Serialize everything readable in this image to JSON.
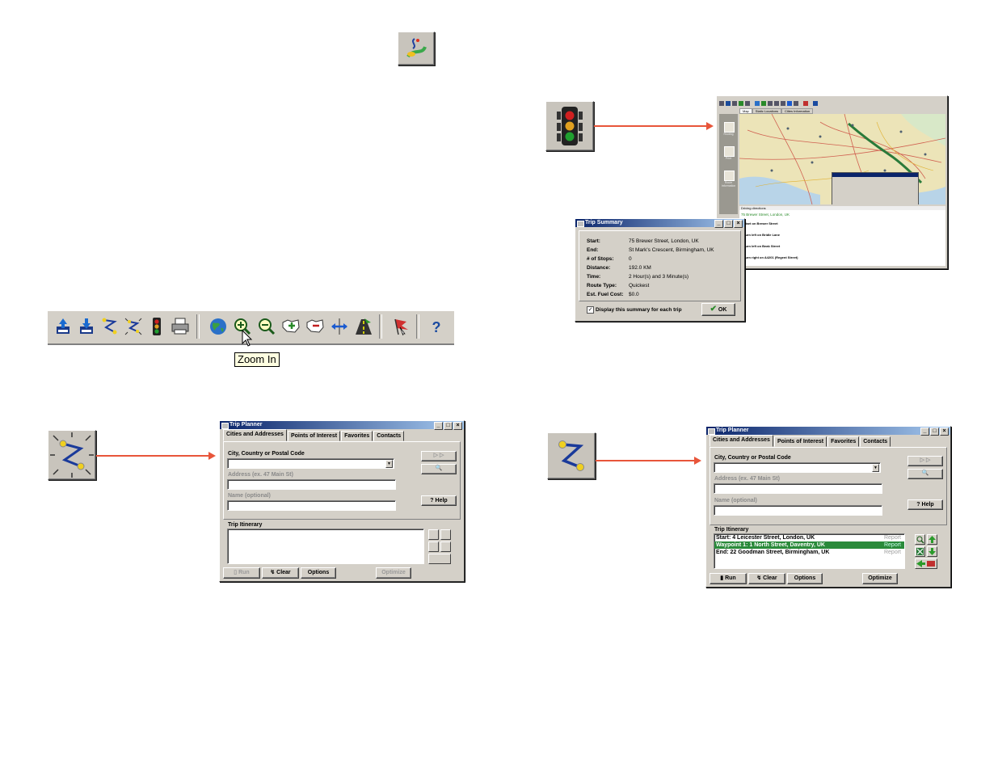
{
  "tooltip": "Zoom In",
  "toolbar": {
    "buttons": [
      "send-to-device-icon",
      "receive-from-device-icon",
      "route-icon",
      "optimize-route-icon",
      "traffic-light-icon",
      "print-icon",
      "globe-icon",
      "zoom-in-icon",
      "zoom-out-icon",
      "zoom-map-in-icon",
      "zoom-map-out-icon",
      "pan-icon",
      "road-icon",
      "flag-icon",
      "help-icon"
    ]
  },
  "trip_planner": {
    "title": "Trip Planner",
    "tabs": [
      "Cities and Addresses",
      "Points of Interest",
      "Favorites",
      "Contacts"
    ],
    "city_label": "City, Country or Postal Code",
    "address_label": "Address (ex. 47 Main St)",
    "name_label": "Name (optional)",
    "help_label": "? Help",
    "itinerary_label": "Trip Itinerary",
    "run_label": "Run",
    "clear_label": "Clear",
    "options_label": "Options",
    "optimize_label": "Optimize"
  },
  "itinerary": [
    {
      "text": "Start: 4 Leicester Street, London, UK",
      "report": "Report"
    },
    {
      "text": "Waypoint 1: 1 North Street, Daventry, UK",
      "report": "Report"
    },
    {
      "text": "End: 22 Goodman Street, Birmingham, UK",
      "report": "Report"
    }
  ],
  "trip_summary": {
    "title": "Trip Summary",
    "rows": [
      {
        "label": "Start:",
        "value": "75 Brewer Street, London, UK"
      },
      {
        "label": "End:",
        "value": "St Mark's Crescent, Birmingham, UK"
      },
      {
        "label": "# of Stops:",
        "value": "0"
      },
      {
        "label": "Distance:",
        "value": "192.0 KM"
      },
      {
        "label": "Time:",
        "value": "2 Hour(s) and 3 Minute(s)"
      },
      {
        "label": "Route Type:",
        "value": "Quickest"
      },
      {
        "label": "Est. Fuel Cost:",
        "value": "$0.0"
      }
    ],
    "checkbox_label": "Display this summary for each trip",
    "ok_label": "OK"
  },
  "map_window": {
    "tabs": [
      "Map",
      "Static Locations",
      "Cities Information"
    ],
    "side_labels": [
      "Routing",
      "Print",
      "Route Information"
    ],
    "directions_title": "Driving directions",
    "directions_start": "75 Brewer Street, London, UK",
    "directions": [
      "1  Start on Brewer Street",
      "2  Turn left on Bridle Lane",
      "3  Turn left on Beak Street",
      "4  Turn right on A4201 (Regent Street)"
    ]
  },
  "colors": {
    "accent_arrow": "#e8553a",
    "selection": "#2a8a3a",
    "title_bar": "#0a246a"
  }
}
